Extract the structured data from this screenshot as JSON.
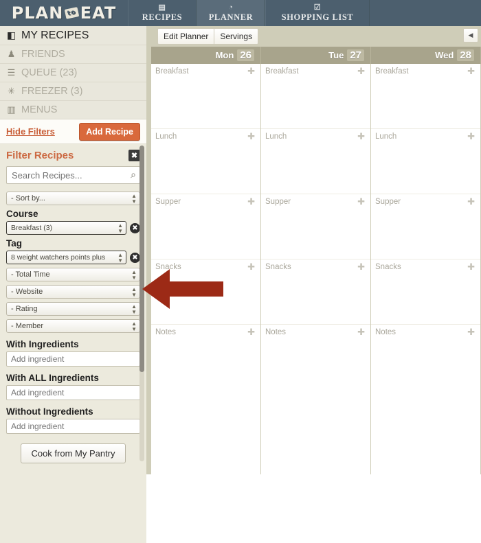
{
  "nav": {
    "logo": {
      "word1": "PLAN",
      "badge": "to",
      "word2": "EAT"
    },
    "tabs": [
      {
        "label": "RECIPES",
        "icon": "recipes-icon",
        "glyph": "▤",
        "active": false
      },
      {
        "label": "PLANNER",
        "icon": "planner-icon",
        "glyph": "◔",
        "active": true
      },
      {
        "label": "SHOPPING LIST",
        "icon": "shopping-list-icon",
        "glyph": "☑",
        "active": false
      }
    ]
  },
  "sidebar": {
    "items": [
      {
        "label": "MY RECIPES",
        "icon": "book-icon",
        "glyph": "◧"
      },
      {
        "label": "FRIENDS",
        "icon": "person-icon",
        "glyph": "♟"
      },
      {
        "label": "QUEUE (23)",
        "icon": "list-icon",
        "glyph": "☰"
      },
      {
        "label": "FREEZER (3)",
        "icon": "snowflake-icon",
        "glyph": "✳"
      },
      {
        "label": "MENUS",
        "icon": "open-book-icon",
        "glyph": "▥"
      }
    ],
    "hide_filters": "Hide Filters",
    "add_recipe": "Add Recipe"
  },
  "filters": {
    "title": "Filter Recipes",
    "close_label": "✖",
    "search": {
      "placeholder": "Search Recipes...",
      "value": "",
      "icon": "search-icon",
      "glyph": "⌕"
    },
    "sort_by": "- Sort by...",
    "course_label": "Course",
    "course_value": "Breakfast (3)",
    "tag_label": "Tag",
    "tag_value": "8 weight watchers points plus",
    "total_time": "- Total Time",
    "website": "- Website",
    "rating": "- Rating",
    "member": "- Member",
    "with_ingredients_label": "With Ingredients",
    "with_ingredients_placeholder": "Add ingredient",
    "with_all_ingredients_label": "With ALL Ingredients",
    "with_all_ingredients_placeholder": "Add ingredient",
    "without_ingredients_label": "Without Ingredients",
    "without_ingredients_placeholder": "Add ingredient",
    "pantry_button": "Cook from My Pantry",
    "clear_label": "✖"
  },
  "planner": {
    "edit_planner": "Edit Planner",
    "servings": "Servings",
    "collapse_icon": "◀",
    "days": [
      {
        "name": "Mon",
        "date": "26"
      },
      {
        "name": "Tue",
        "date": "27"
      },
      {
        "name": "Wed",
        "date": "28"
      }
    ],
    "meals": [
      "Breakfast",
      "Lunch",
      "Supper",
      "Snacks",
      "Notes"
    ],
    "add_glyph": "✚"
  },
  "annotation": {
    "type": "arrow",
    "direction": "left",
    "color": "#9c2a16",
    "points_at": "tag-filter-clear-button"
  },
  "colors": {
    "nav_bg": "#4c5f6e",
    "nav_active": "#5a6c7a",
    "sidebar_bg": "#cfcdb8",
    "panel_bg": "#eceadd",
    "accent_orange": "#d9693c",
    "day_header": "#a8a48c",
    "annotation_red": "#9c2a16"
  }
}
